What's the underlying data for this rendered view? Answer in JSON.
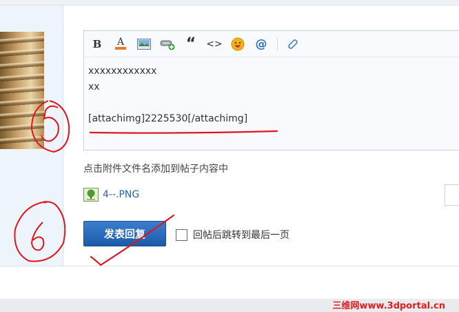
{
  "editor": {
    "toolbar": [
      {
        "name": "bold",
        "label": "B"
      },
      {
        "name": "font-color",
        "label": "A"
      },
      {
        "name": "image"
      },
      {
        "name": "attachment-add"
      },
      {
        "name": "quote",
        "label": "“"
      },
      {
        "name": "code",
        "label": "<>"
      },
      {
        "name": "emoticon"
      },
      {
        "name": "mention",
        "label": "@"
      },
      {
        "name": "link"
      }
    ],
    "lines": [
      "xxxxxxxxxxxx",
      "xx",
      "",
      "[attachimg]2225530[/attachimg]"
    ]
  },
  "hint": "点击附件文件名添加到帖子内容中",
  "attachment": {
    "filename": "4--.PNG"
  },
  "submit": {
    "label": "发表回复"
  },
  "jump_to_last": {
    "label": "回帖后跳转到最后一页",
    "checked": false
  },
  "annotations": {
    "step5": "5",
    "step6": "6"
  },
  "watermark": "三维网www.3dportal.cn",
  "colors": {
    "accent_button": "#1c5aa8",
    "link": "#2366a8",
    "annotation": "#e0141e",
    "panel": "#eef4fb"
  }
}
